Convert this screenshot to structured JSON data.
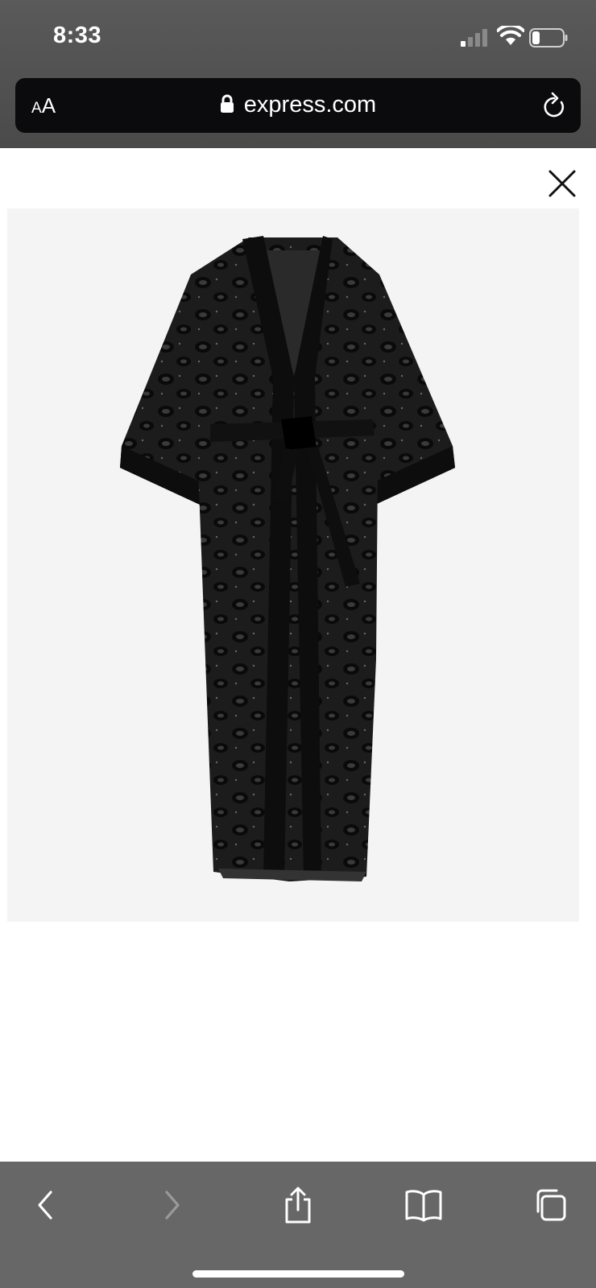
{
  "status_bar": {
    "time": "8:33"
  },
  "browser": {
    "text_size_label_small": "A",
    "text_size_label_large": "A",
    "url": "express.com"
  },
  "icons": {
    "close": "close-icon",
    "lock": "lock-icon",
    "reload": "reload-icon",
    "back": "chevron-left-icon",
    "forward": "chevron-right-icon",
    "share": "share-icon",
    "bookmarks": "book-icon",
    "tabs": "tabs-icon"
  },
  "colors": {
    "chrome": "#4f4f4f",
    "address_bar": "#0b0b0d",
    "image_bg": "#f4f4f4",
    "toolbar": "#676767",
    "garment": "#151515"
  },
  "toolbar": {
    "forward_enabled": false
  }
}
